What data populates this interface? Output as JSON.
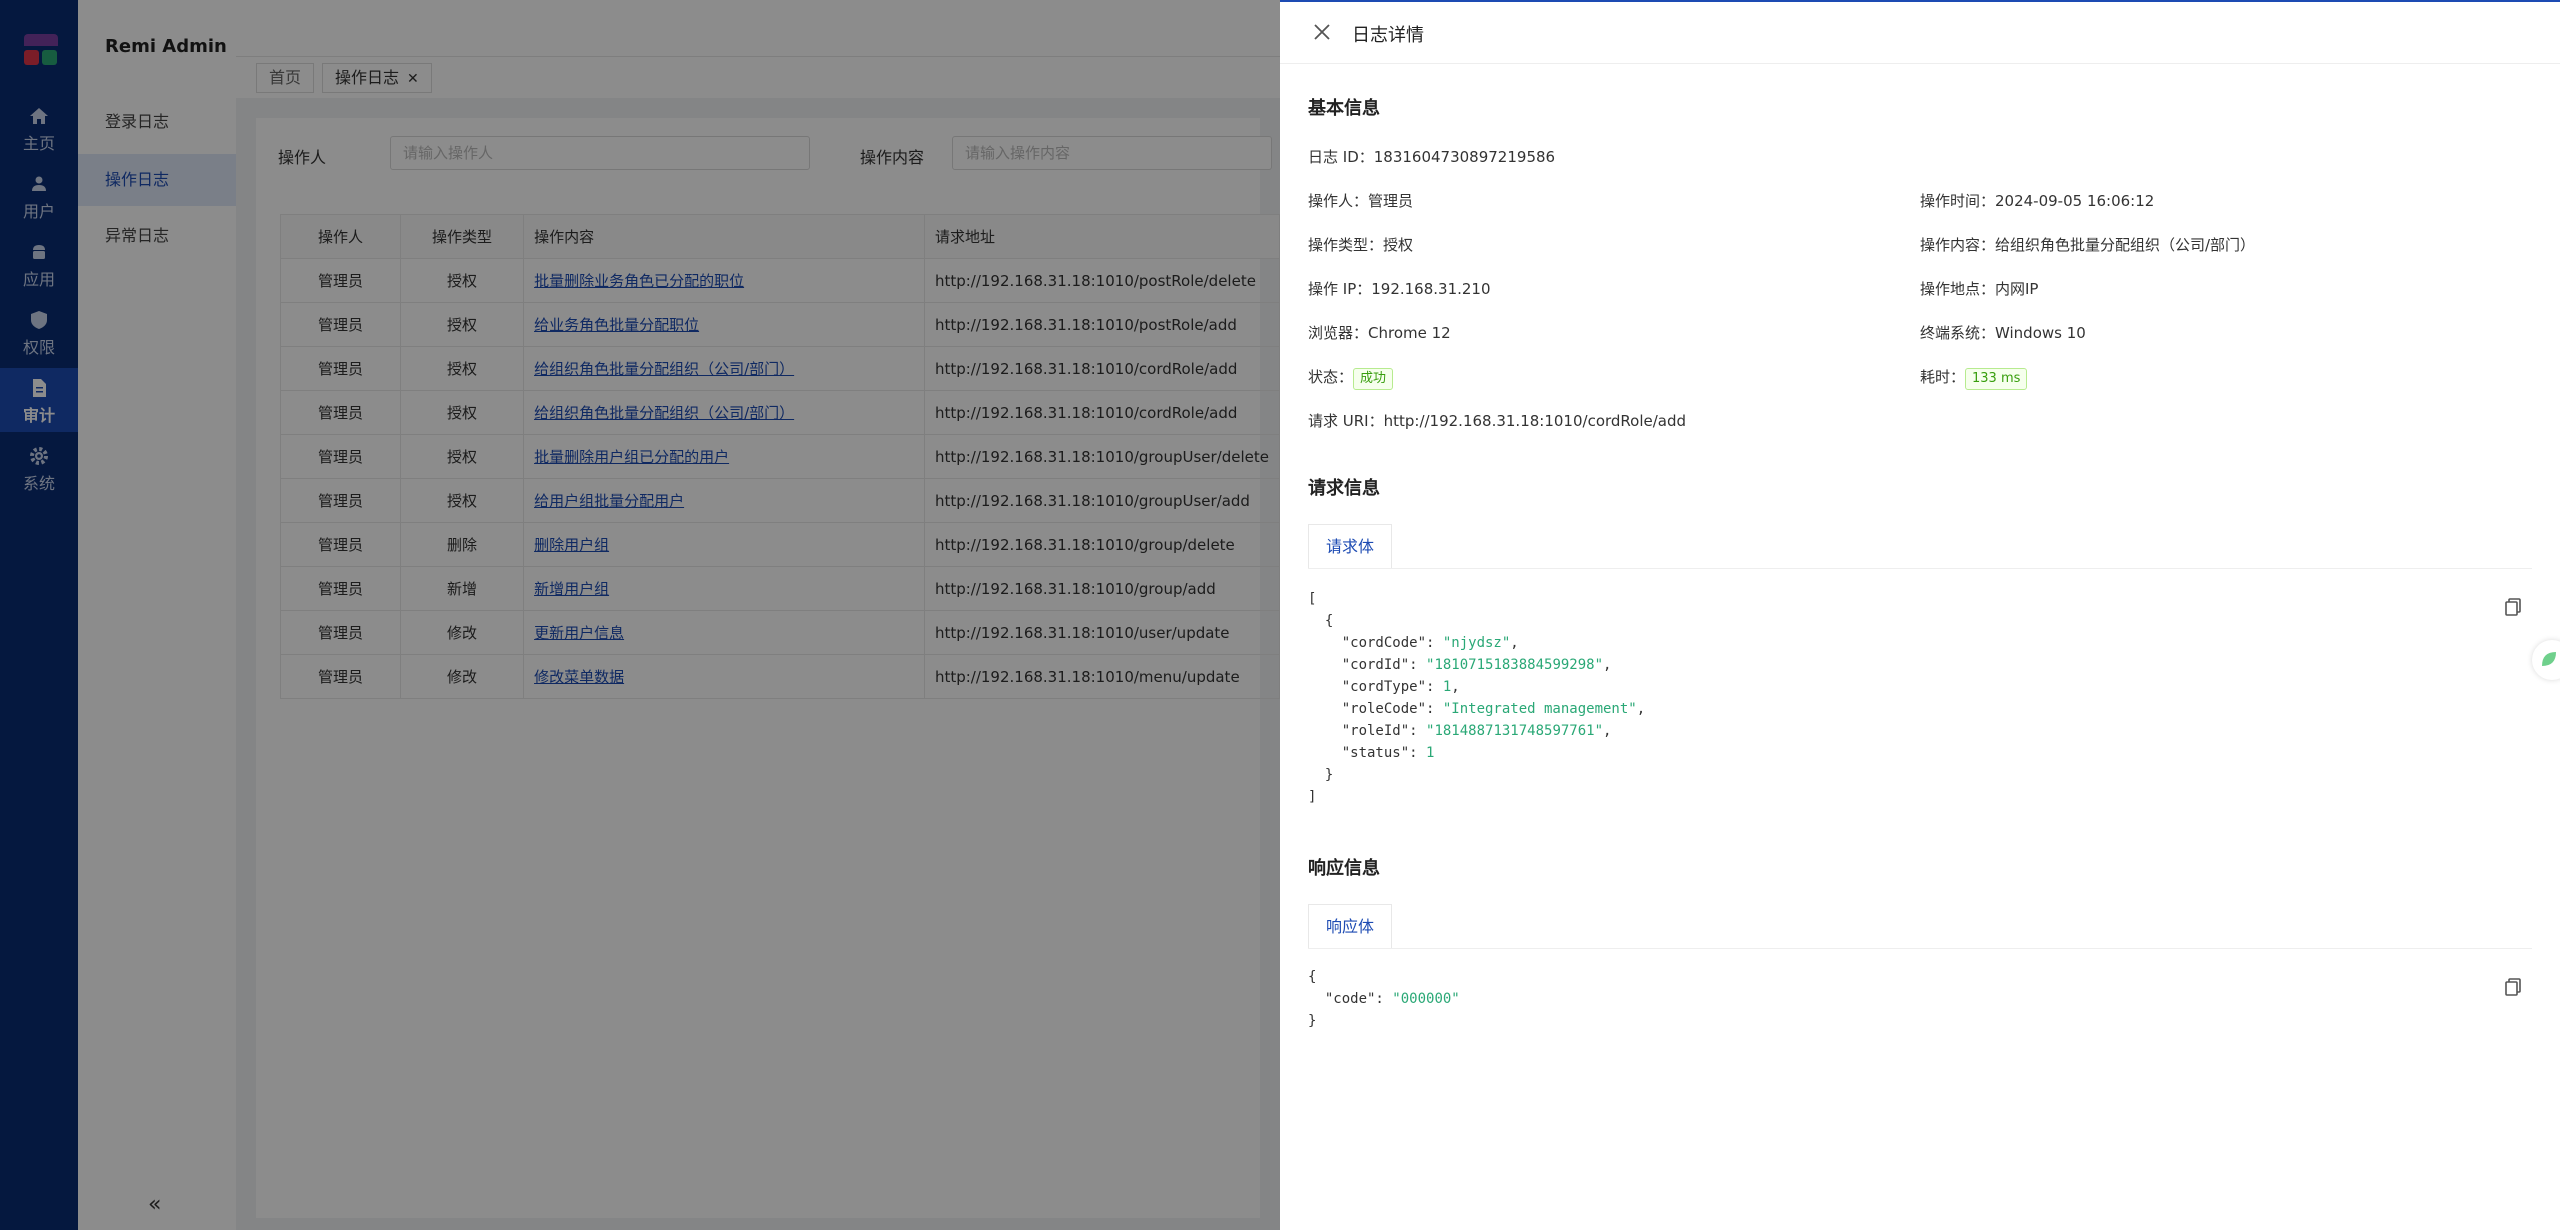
{
  "app": {
    "brand": "Remi Admin"
  },
  "rail": [
    {
      "label": "主页",
      "icon": "home-icon"
    },
    {
      "label": "用户",
      "icon": "users-icon"
    },
    {
      "label": "应用",
      "icon": "android-icon"
    },
    {
      "label": "权限",
      "icon": "shield-icon"
    },
    {
      "label": "审计",
      "icon": "document-icon",
      "active": true
    },
    {
      "label": "系统",
      "icon": "gear-icon"
    }
  ],
  "submenu": [
    {
      "label": "登录日志"
    },
    {
      "label": "操作日志",
      "active": true
    },
    {
      "label": "异常日志"
    }
  ],
  "tabs": [
    {
      "label": "首页"
    },
    {
      "label": "操作日志",
      "closable": true
    }
  ],
  "filters": {
    "operator_label": "操作人",
    "operator_placeholder": "请输入操作人",
    "content_label": "操作内容",
    "content_placeholder": "请输入操作内容"
  },
  "table": {
    "headers": [
      "操作人",
      "操作类型",
      "操作内容",
      "请求地址"
    ],
    "rows": [
      [
        "管理员",
        "授权",
        "批量删除业务角色已分配的职位",
        "http://192.168.31.18:1010/postRole/delete"
      ],
      [
        "管理员",
        "授权",
        "给业务角色批量分配职位",
        "http://192.168.31.18:1010/postRole/add"
      ],
      [
        "管理员",
        "授权",
        "给组织角色批量分配组织（公司/部门）",
        "http://192.168.31.18:1010/cordRole/add"
      ],
      [
        "管理员",
        "授权",
        "给组织角色批量分配组织（公司/部门）",
        "http://192.168.31.18:1010/cordRole/add"
      ],
      [
        "管理员",
        "授权",
        "批量删除用户组已分配的用户",
        "http://192.168.31.18:1010/groupUser/delete"
      ],
      [
        "管理员",
        "授权",
        "给用户组批量分配用户",
        "http://192.168.31.18:1010/groupUser/add"
      ],
      [
        "管理员",
        "删除",
        "删除用户组",
        "http://192.168.31.18:1010/group/delete"
      ],
      [
        "管理员",
        "新增",
        "新增用户组",
        "http://192.168.31.18:1010/group/add"
      ],
      [
        "管理员",
        "修改",
        "更新用户信息",
        "http://192.168.31.18:1010/user/update"
      ],
      [
        "管理员",
        "修改",
        "修改菜单数据",
        "http://192.168.31.18:1010/menu/update"
      ]
    ]
  },
  "drawer": {
    "title": "日志详情",
    "basic_title": "基本信息",
    "log_id": "日志 ID：1831604730897219586",
    "operator": "操作人：管理员",
    "op_time": "操作时间：2024-09-05 16:06:12",
    "op_type": "操作类型：授权",
    "op_content": "操作内容：给组织角色批量分配组织（公司/部门）",
    "op_ip": "操作 IP：192.168.31.210",
    "op_location": "操作地点：内网IP",
    "browser": "浏览器：Chrome 12",
    "os": "终端系统：Windows 10",
    "status_label": "状态：",
    "status_value": "成功",
    "duration_label": "耗时：",
    "duration_value": "133 ms",
    "request_uri": "请求 URI：http://192.168.31.18:1010/cordRole/add",
    "request_title": "请求信息",
    "request_tab": "请求体",
    "request_body": {
      "cordCode": "\"njydsz\"",
      "cordId": "\"1810715183884599298\"",
      "cordType": "1",
      "roleCode": "\"Integrated management\"",
      "roleId": "\"1814887131748597761\"",
      "status": "1"
    },
    "response_title": "响应信息",
    "response_tab": "响应体",
    "response_body": {
      "code": "\"000000\""
    }
  },
  "colors": {
    "rail": "#0a2d74",
    "accent": "#1d4bb3",
    "success": "#389e0d"
  }
}
